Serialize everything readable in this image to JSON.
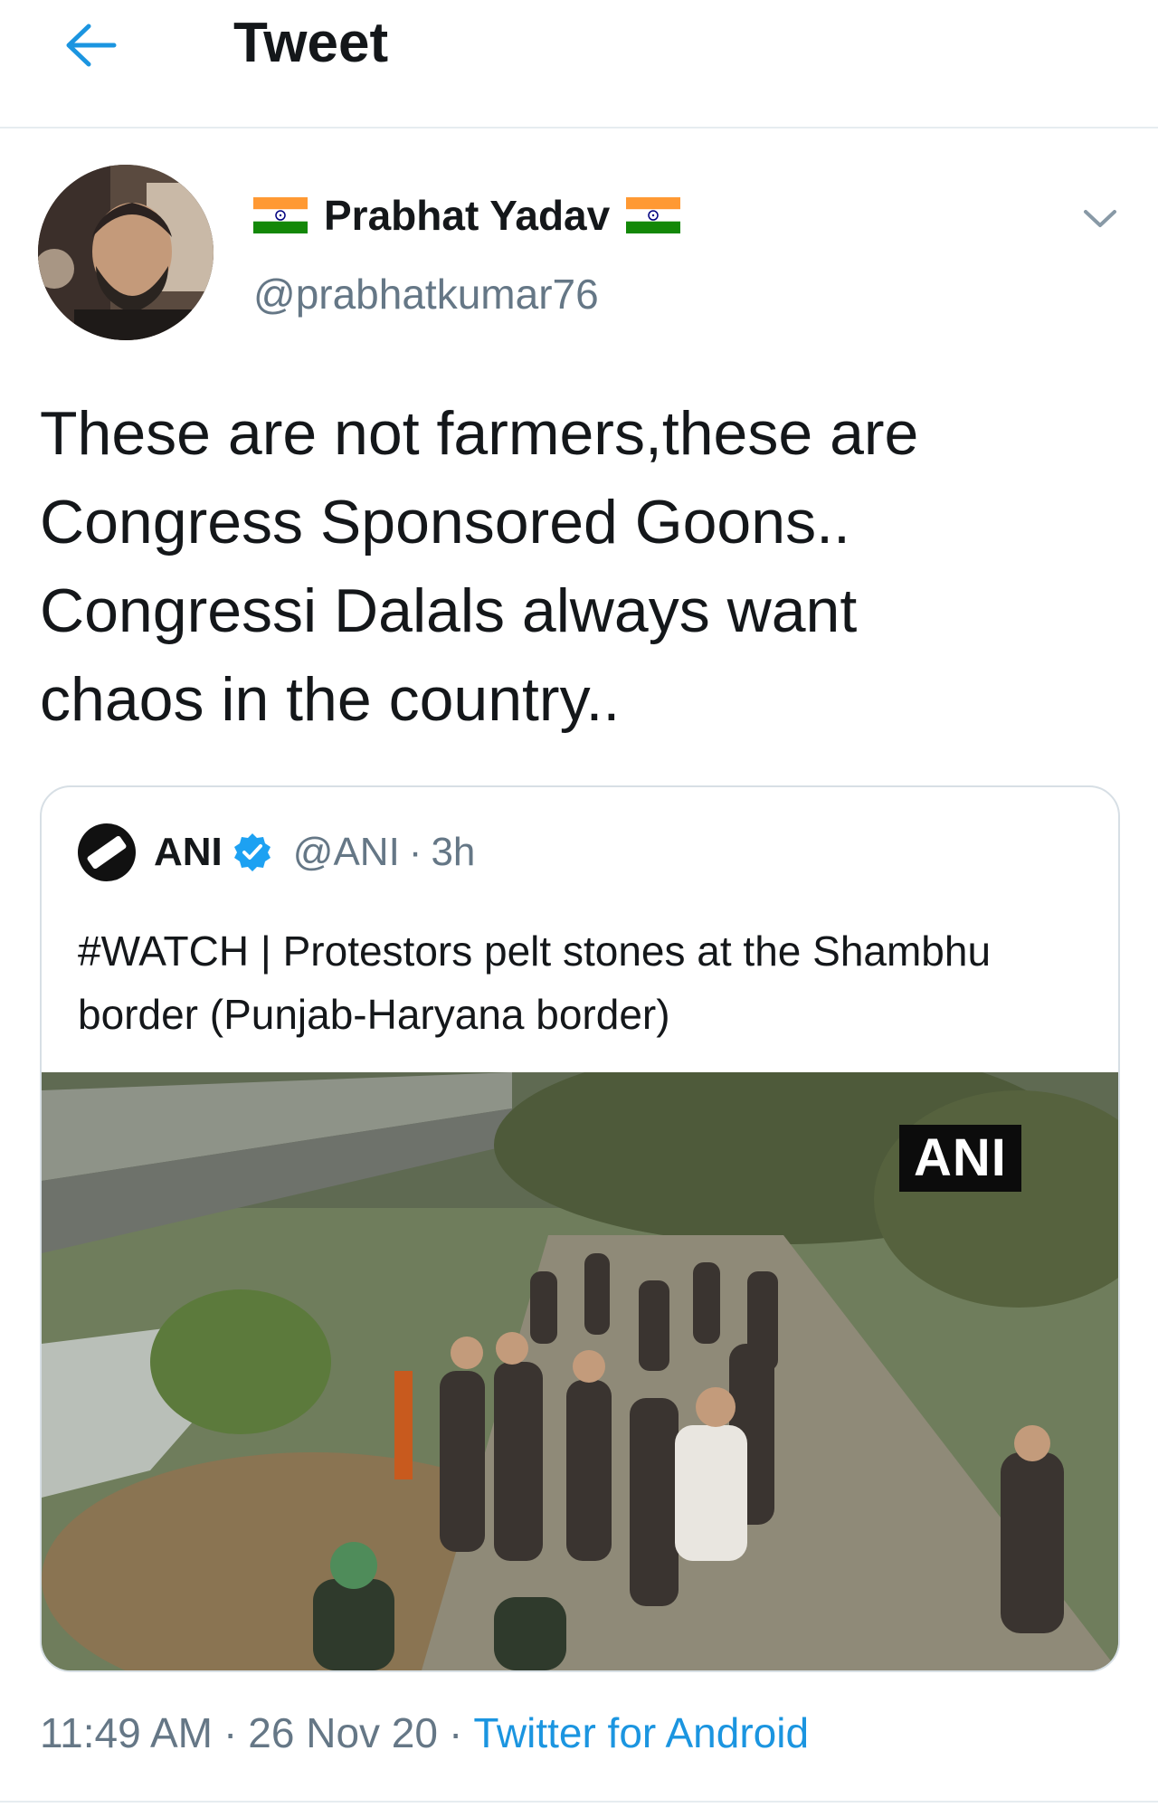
{
  "header": {
    "title": "Tweet",
    "back_icon": "arrow-left-icon",
    "accent_color": "#1b95e0"
  },
  "author": {
    "display_name": "Prabhat Yadav",
    "handle": "@prabhatkumar76",
    "name_badges": [
      "india-flag-icon",
      "india-flag-icon"
    ]
  },
  "tweet": {
    "text": "These are not farmers,these are\nCongress Sponsored Goons..\nCongressi Dalals always want\nchaos in the country.."
  },
  "quoted_tweet": {
    "name": "ANI",
    "verified": true,
    "handle": "@ANI",
    "separator": "·",
    "time": "3h",
    "text": "#WATCH | Protestors pelt stones at the Shambhu border (Punjab-Haryana border)",
    "media": {
      "description_icon": "video-thumbnail",
      "watermark": "ANI"
    }
  },
  "meta": {
    "time": "11:49 AM",
    "sep1": "·",
    "date": "26 Nov 20",
    "sep2": "·",
    "source": "Twitter for Android"
  }
}
